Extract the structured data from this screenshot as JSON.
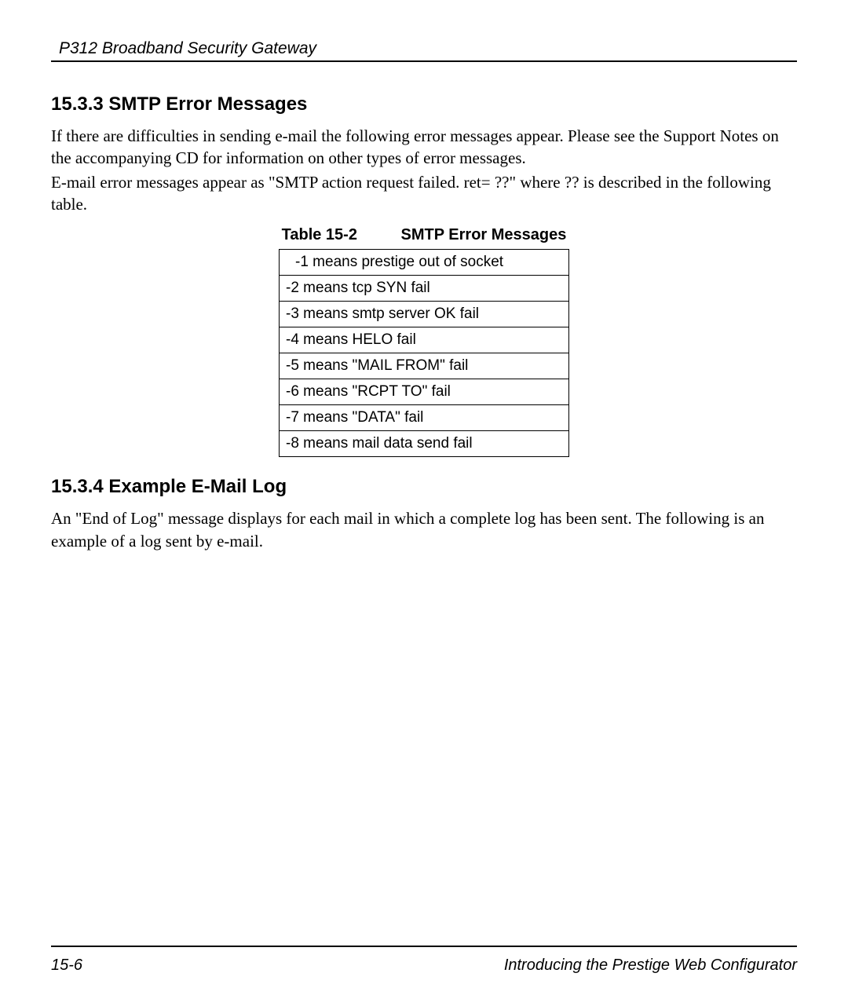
{
  "header": {
    "title": "P312  Broadband Security Gateway"
  },
  "section1": {
    "heading": "15.3.3 SMTP Error Messages",
    "para1": "If there are difficulties in sending e-mail the following error messages appear. Please see the Support Notes on the accompanying CD for information on other types of error messages.",
    "para2": "E-mail error messages appear as \"SMTP action request failed. ret= ??\"  where ?? is described in the following table."
  },
  "table": {
    "caption_label": "Table 15-2",
    "caption_title": "SMTP Error Messages",
    "rows": [
      "-1 means prestige out of socket",
      "-2 means tcp SYN fail",
      "-3 means smtp server OK fail",
      "-4 means HELO fail",
      "-5 means \"MAIL FROM\" fail",
      "-6 means \"RCPT TO\" fail",
      "-7 means \"DATA\" fail",
      "-8 means mail data send fail"
    ]
  },
  "section2": {
    "heading": "15.3.4 Example E-Mail Log",
    "para1": "An \"End of Log\" message displays for each mail in which a complete log has been sent. The following is an example of a log sent by e-mail."
  },
  "footer": {
    "page": "15-6",
    "title": "Introducing the Prestige Web Configurator"
  }
}
